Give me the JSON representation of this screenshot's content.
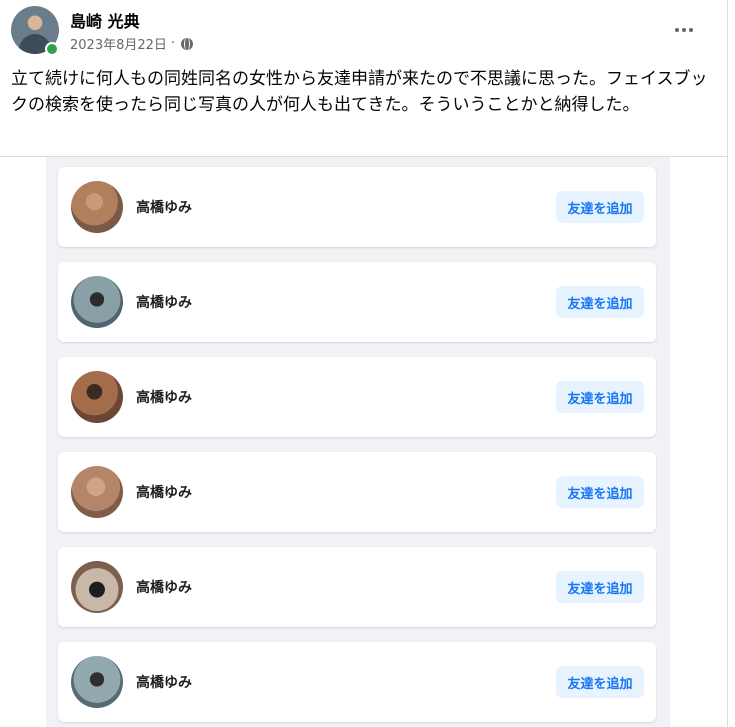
{
  "post": {
    "author": "島崎 光典",
    "date": "2023年8月22日",
    "separator": "·",
    "text": "立て続けに何人もの同姓同名の女性から友達申請が来たので不思議に思った。フェイスブックの検索を使ったら同じ写真の人が何人も出てきた。そういうことかと納得した。"
  },
  "friend_requests": [
    {
      "name": "高橋ゆみ",
      "button": "友達を追加"
    },
    {
      "name": "高橋ゆみ",
      "button": "友達を追加"
    },
    {
      "name": "高橋ゆみ",
      "button": "友達を追加"
    },
    {
      "name": "高橋ゆみ",
      "button": "友達を追加"
    },
    {
      "name": "高橋ゆみ",
      "button": "友達を追加"
    },
    {
      "name": "高橋ゆみ",
      "button": "友達を追加"
    }
  ],
  "colors": {
    "online": "#31a24c",
    "button_bg": "#e7f3ff",
    "button_text": "#1877f2",
    "media_bg": "#f0f2f5"
  }
}
